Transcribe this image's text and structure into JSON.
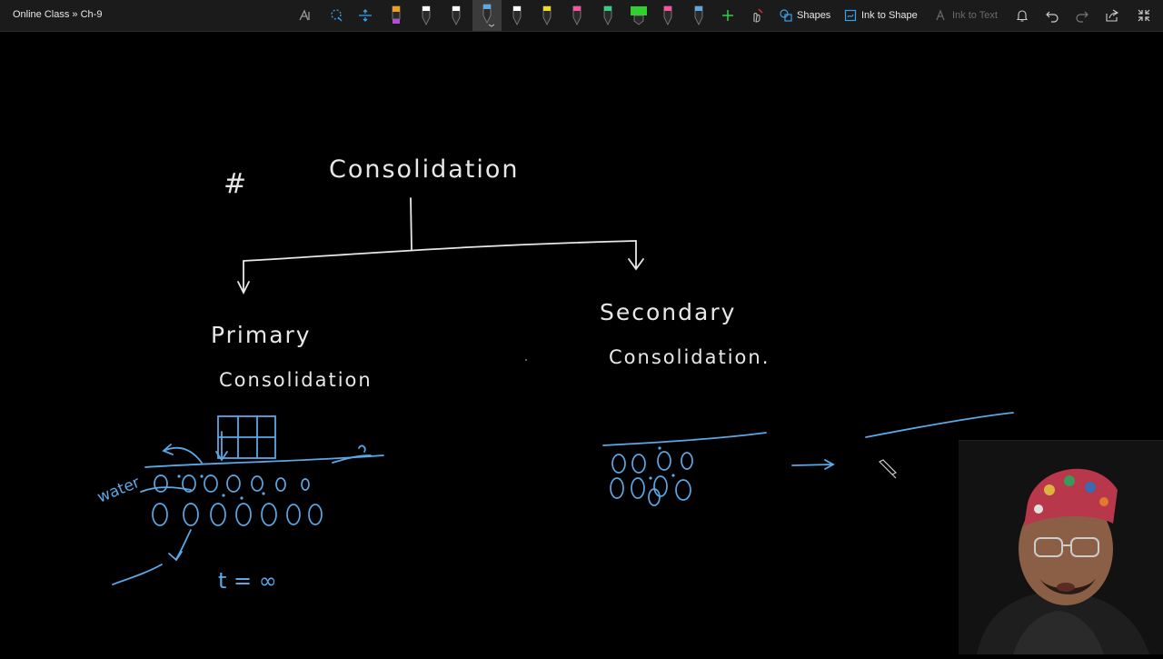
{
  "window": {
    "title": "Online Class » Ch-9"
  },
  "toolbar": {
    "pen_colors": [
      "#f0a020",
      "#ffffff",
      "#ffffff",
      "#5aa8e6",
      "#ffffff",
      "#e8e020",
      "#ff4fa0",
      "#30d080",
      "#30d030",
      "#ff4fa0",
      "#5aa8e6"
    ],
    "shapes_label": "Shapes",
    "ink_to_shape_label": "Ink to Shape",
    "ink_to_text_label": "Ink to Text"
  },
  "canvas": {
    "ink_color": "#e8e8e8",
    "accent_ink_color": "#5aa8e6",
    "hash_symbol": "#",
    "heading": "Consolidation",
    "primary_label_line1": "Primary",
    "primary_label_line2": "Consolidation",
    "secondary_label_line1": "Secondary",
    "secondary_label_line2": "Consolidation.",
    "water_label": "water",
    "time_label": "t = ∞"
  }
}
